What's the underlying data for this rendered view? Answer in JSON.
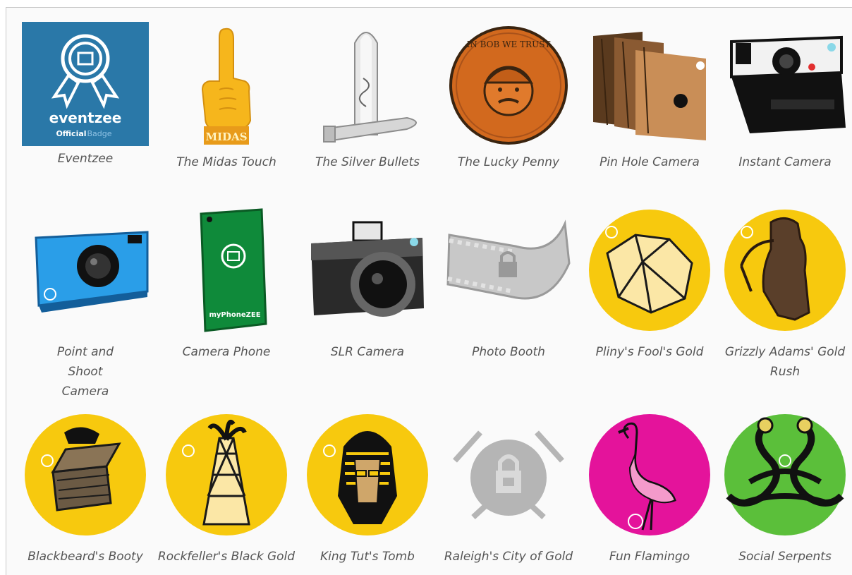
{
  "badges": [
    {
      "name": "Eventzee"
    },
    {
      "name": "The Midas Touch"
    },
    {
      "name": "The Silver Bullets"
    },
    {
      "name": "The Lucky Penny"
    },
    {
      "name": "Pin Hole Camera"
    },
    {
      "name": "Instant Camera"
    },
    {
      "name": "Point and Shoot Camera"
    },
    {
      "name": "Camera Phone"
    },
    {
      "name": "SLR Camera"
    },
    {
      "name": "Photo Booth"
    },
    {
      "name": "Pliny's Fool's Gold"
    },
    {
      "name": "Grizzly Adams' Gold Rush"
    },
    {
      "name": "Blackbeard's Booty"
    },
    {
      "name": "Rockfeller's Black Gold"
    },
    {
      "name": "King Tut's Tomb"
    },
    {
      "name": "Raleigh's City of Gold"
    },
    {
      "name": "Fun Flamingo"
    },
    {
      "name": "Social Serpents"
    }
  ],
  "eventzee_badge": {
    "brand": "eventzee",
    "official": "Official",
    "badge_word": "Badge"
  },
  "midas_sign": "MIDAS",
  "penny_text": "IN BOB WE TRUST",
  "phone_label": "myPhoneZEE",
  "colors": {
    "eventzee_blue": "#2a78a8",
    "gold": "#f7c90e",
    "magenta": "#e4139b",
    "green": "#5bbf3a",
    "copper": "#d2691e",
    "locked_gray": "#b5b5b5"
  }
}
